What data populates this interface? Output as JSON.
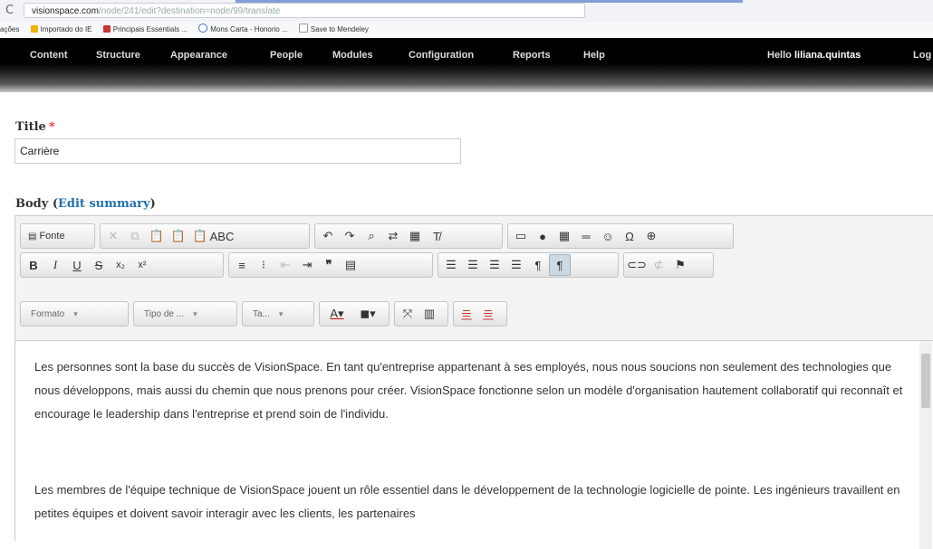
{
  "browser": {
    "nav_back": "C",
    "url_host": "visionspace.com",
    "url_path": "/node/241/edit?destination=node/99/translate",
    "bookmarks": [
      "ações",
      "Importado do IE",
      "Principais Essentials ...",
      "Mons Carta - Honorio ...",
      "Save to Mendeley"
    ]
  },
  "admin_menu": {
    "items": [
      "Content",
      "Structure",
      "Appearance",
      "People",
      "Modules",
      "Configuration",
      "Reports",
      "Help"
    ],
    "hello": "Hello",
    "username": "liliana.quintas",
    "logout": "Log"
  },
  "form": {
    "title_label": "Title",
    "required_mark": "*",
    "title_value": "Carrière",
    "body_label": "Body",
    "edit_summary": "Edit summary"
  },
  "editor": {
    "source_button": "Fonte",
    "format_combo": "Formato",
    "font_combo": "Tipo de ...",
    "size_combo": "Ta...",
    "paragraphs": [
      "Les personnes sont la base du succès de VisionSpace. En tant qu'entreprise appartenant à ses employés, nous nous soucions non seulement des technologies que nous développons, mais aussi du chemin que nous prenons pour créer. VisionSpace fonctionne selon un modèle d'organisation hautement collaboratif qui reconnaît et encourage le leadership dans l'entreprise et prend soin de l'individu.",
      "Les membres de l'équipe technique de VisionSpace jouent un rôle essentiel dans le développement de la technologie logicielle de pointe. Les ingénieurs travaillent en petites équipes et doivent savoir interagir avec les clients, les partenaires"
    ]
  },
  "colors": {
    "toolbar_bg": "#000000",
    "link_blue": "#1f6fb0",
    "required_red": "#e33333"
  }
}
